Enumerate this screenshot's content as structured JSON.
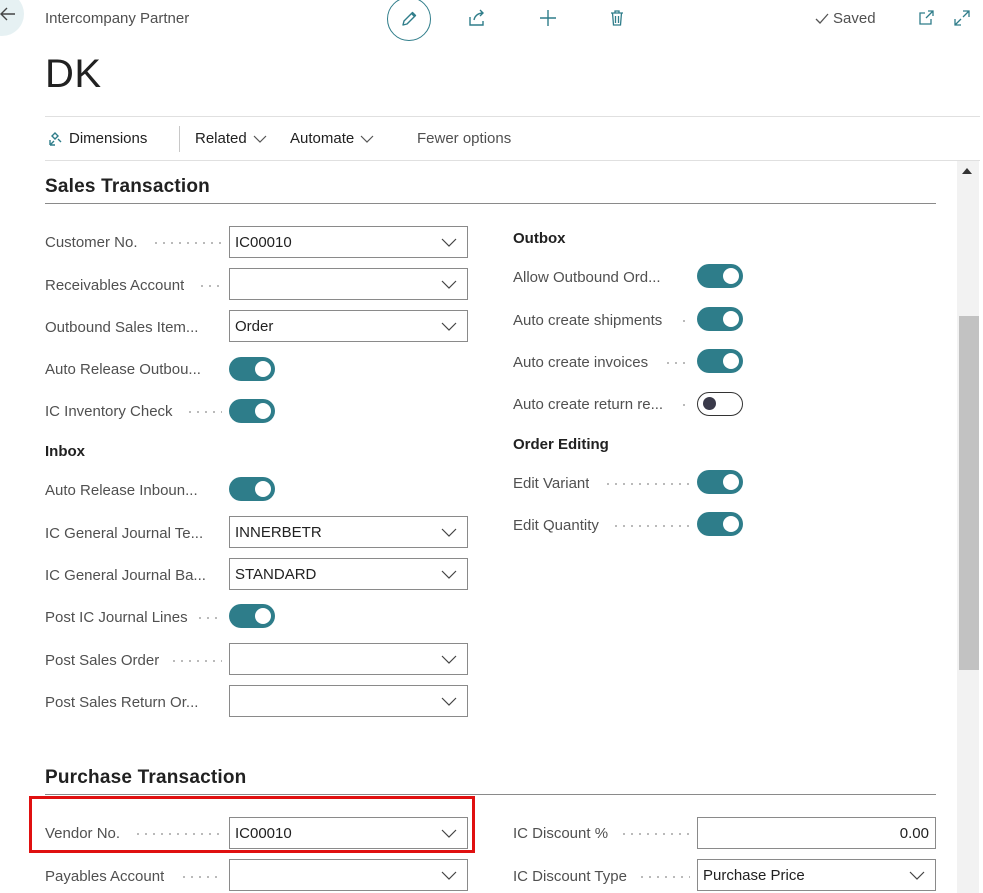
{
  "header": {
    "breadcrumb": "Intercompany Partner",
    "title": "DK",
    "status": "Saved"
  },
  "actions": {
    "dimensions": "Dimensions",
    "related": "Related",
    "automate": "Automate",
    "fewer_options": "Fewer options"
  },
  "sales": {
    "title": "Sales Transaction",
    "customer_no": {
      "label": "Customer No.",
      "value": "IC00010"
    },
    "receivables_account": {
      "label": "Receivables Account",
      "value": ""
    },
    "outbound_sales_item": {
      "label": "Outbound Sales Item...",
      "value": "Order"
    },
    "auto_release_outbound": {
      "label": "Auto Release Outbou...",
      "on": true
    },
    "ic_inventory_check": {
      "label": "IC Inventory Check",
      "on": true
    },
    "inbox_title": "Inbox",
    "auto_release_inbound": {
      "label": "Auto Release Inboun...",
      "on": true
    },
    "ic_gen_journal_template": {
      "label": "IC General Journal Te...",
      "value": "INNERBETR"
    },
    "ic_gen_journal_batch": {
      "label": "IC General Journal Ba...",
      "value": "STANDARD"
    },
    "post_ic_journal_lines": {
      "label": "Post IC Journal Lines",
      "on": true
    },
    "post_sales_order": {
      "label": "Post Sales Order",
      "value": ""
    },
    "post_sales_return_order": {
      "label": "Post Sales Return Or...",
      "value": ""
    },
    "outbox_title": "Outbox",
    "allow_outbound_order": {
      "label": "Allow Outbound Ord...",
      "on": true
    },
    "auto_create_shipments": {
      "label": "Auto create shipments",
      "on": true
    },
    "auto_create_invoices": {
      "label": "Auto create invoices",
      "on": true
    },
    "auto_create_return": {
      "label": "Auto create return re...",
      "on": false
    },
    "order_editing_title": "Order Editing",
    "edit_variant": {
      "label": "Edit Variant",
      "on": true
    },
    "edit_quantity": {
      "label": "Edit Quantity",
      "on": true
    }
  },
  "purchase": {
    "title": "Purchase Transaction",
    "vendor_no": {
      "label": "Vendor No.",
      "value": "IC00010"
    },
    "payables_account": {
      "label": "Payables Account",
      "value": ""
    },
    "ic_discount_pct": {
      "label": "IC Discount %",
      "value": "0.00"
    },
    "ic_discount_type": {
      "label": "IC Discount Type",
      "value": "Purchase Price"
    }
  },
  "colors": {
    "accent": "#2e7d8a",
    "highlight": "#e01010"
  }
}
